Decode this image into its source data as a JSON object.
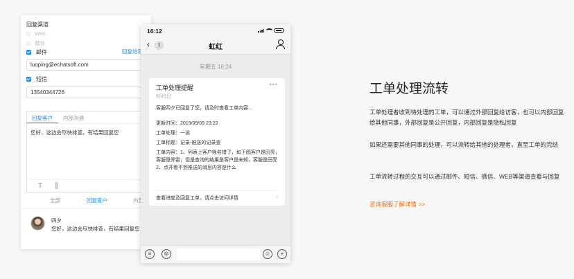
{
  "reply_panel": {
    "title": "回复渠道",
    "channels": [
      {
        "label": "Web",
        "checked": false,
        "disabled": true
      },
      {
        "label": "微信",
        "checked": false,
        "disabled": true
      },
      {
        "label": "邮件",
        "checked": true,
        "disabled": false
      },
      {
        "label": "短信",
        "checked": true,
        "disabled": false
      }
    ],
    "reply_other_link": "回复给我",
    "email_value": "luoping@echatsoft.com",
    "sms_value": "13540344726",
    "editor_tabs": [
      "回复客户",
      "内部沟通"
    ],
    "editor_content": "您好，这边会尽快排查，有结果回复您",
    "toolbar_icons": [
      "text-format-icon",
      "attachment-icon"
    ],
    "filter_tabs": [
      "全部",
      "回复客户",
      "内部"
    ],
    "message": {
      "author": "四夕",
      "text": "您好，这边会尽快排查，有结果回复您"
    }
  },
  "phone": {
    "status_time": "16:12",
    "chat_title": "虹红",
    "unread_badge": "1",
    "date_stamp": "星期五 16:24",
    "card": {
      "title": "工单处理提醒",
      "date": "9月6日",
      "intro": "客服四夕已回复了您，请及时查看工单内容...",
      "update_time": "更新时间：2019/09/09    23:22",
      "handler": "工单处理：一渝",
      "ticket_title": "工单标题：记录-推送的记录查",
      "ticket_content": "工单内容：1、列表上客户姓名错了，如下图客户是田亮，客服是郑雷，但是查询的结果是客户是未知，客服是田亮 2、点开看不到推送的消息内容是什么",
      "detail_link": "查看进度及回复工单，请点击访问详情"
    }
  },
  "intro": {
    "heading": "工单处理流转",
    "paragraphs": [
      "工单处理者收到待处理的工单，可以通过外部回复给访客，也可以内部回复给其他同事，外部回复是公开回复，内部回复是隐私回复",
      "如果还需要其他同事的处理，可以流转给其他的处理者，直至工单的完结",
      "工单流转过程的交互可以通过邮件、短信、微信、WEB等渠道查看与回复"
    ],
    "consult_link": "咨询客服了解详情 >>"
  },
  "colors": {
    "accent": "#1890ff",
    "link_orange": "#ff6a00"
  }
}
